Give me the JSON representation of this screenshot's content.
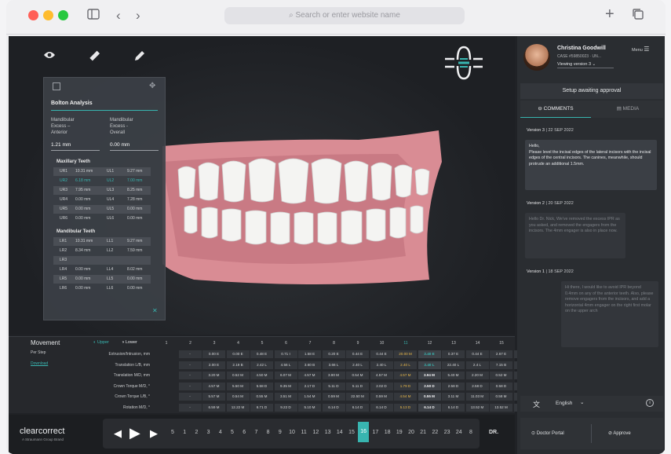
{
  "browser": {
    "url_placeholder": "Search or enter website name",
    "colors": {
      "close": "#ff5f57",
      "minimize": "#febc2e",
      "maximize": "#28c840"
    }
  },
  "toolbar": {
    "tools": [
      {
        "icon": "eye-icon"
      },
      {
        "icon": "ruler-icon"
      },
      {
        "icon": "pencil-icon"
      }
    ]
  },
  "bolton": {
    "title": "Bolton Analysis",
    "anterior_label_1": "Mandibular",
    "anterior_label_2": "Excess –",
    "anterior_label_3": "Anterior",
    "anterior_value": "1.21 mm",
    "overall_label_1": "Mandibular",
    "overall_label_2": "Excess -",
    "overall_label_3": "Overall",
    "overall_value": "0.00 mm",
    "maxillary_title": "Maxillary Teeth",
    "maxillary": [
      {
        "l": "UR1",
        "lv": "10.31 mm",
        "r": "UL1",
        "rv": "9.27 mm"
      },
      {
        "l": "UR2",
        "lv": "6.18 mm",
        "r": "UL2",
        "rv": "7.00 mm"
      },
      {
        "l": "UR3",
        "lv": "7.95 mm",
        "r": "UL3",
        "rv": "8.25 mm"
      },
      {
        "l": "UR4",
        "lv": "0.00 mm",
        "r": "UL4",
        "rv": "7.28 mm"
      },
      {
        "l": "UR5",
        "lv": "0.00 mm",
        "r": "UL5",
        "rv": "0.00 mm"
      },
      {
        "l": "UR6",
        "lv": "0.00 mm",
        "r": "UL6",
        "rv": "0.00 mm"
      }
    ],
    "mandibular_title": "Mandibular Teeth",
    "mandibular": [
      {
        "l": "LR1",
        "lv": "10.31 mm",
        "r": "LL1",
        "rv": "9.27 mm"
      },
      {
        "l": "LR2",
        "lv": "8.34 mm",
        "r": "LL2",
        "rv": "7.59 mm"
      },
      {
        "l": "LR3",
        "lv": "",
        "r": "",
        "rv": ""
      },
      {
        "l": "LR4",
        "lv": "0.00 mm",
        "r": "LL4",
        "rv": "8.02 mm"
      },
      {
        "l": "LR5",
        "lv": "0.00 mm",
        "r": "LL5",
        "rv": "0.00 mm"
      },
      {
        "l": "LR6",
        "lv": "0.00 mm",
        "r": "LL6",
        "rv": "0.00 mm"
      }
    ]
  },
  "movement": {
    "title": "Movement",
    "toggle_upper": "Upper",
    "toggle_lower": "Lower",
    "columns": [
      "1",
      "2",
      "3",
      "4",
      "5",
      "6",
      "7",
      "8",
      "9",
      "10",
      "11",
      "12",
      "13",
      "14",
      "15",
      "16"
    ],
    "per_step_label": "Per Step",
    "download_label": "Download",
    "rows": [
      {
        "label": "Extrusion/Intrusion, mm",
        "cells": [
          "-",
          "0.00 E",
          "0.00 E",
          "0.48 E",
          "0.71 I",
          "1.58 E",
          "0.20 E",
          "0.44 E",
          "0.44 E",
          "20.00 M",
          "2.40 E",
          "0.37 E",
          "0.44 E",
          "2.67 E",
          "0.60 E"
        ]
      },
      {
        "label": "Translation L/B, mm",
        "cells": [
          "-",
          "2.00 E",
          "2.19 B",
          "2.42 L",
          "4.56 L",
          "3.60 B",
          "3.66 L",
          "2.40 L",
          "2.40 L",
          "2.40 L",
          "2.40 L",
          "22.40 L",
          "2.4 L",
          "7.15 B",
          "5.23 L"
        ]
      },
      {
        "label": "Translation M/D, mm",
        "cells": [
          "-",
          "3.20 M",
          "0.52 M",
          "4.50 M",
          "6.07 M",
          "4.57 M",
          "3.90 M",
          "0.54 M",
          "4.57 M",
          "4.57 M",
          "3.94 M",
          "5.40 M",
          "2.20 M",
          "0.52 M",
          "0.54 M"
        ]
      },
      {
        "label": "Crown Torque M/D, °",
        "cells": [
          "-",
          "4.57 M",
          "5.50 M",
          "5.58 D",
          "9.35 M",
          "2.17 D",
          "5.11 D",
          "5.11 D",
          "2.02 D",
          "1.79 D",
          "2.50 D",
          "2.58 D",
          "2.58 D",
          "0.58 D",
          "2.20 M"
        ]
      },
      {
        "label": "Crown Torque L/B, °",
        "cells": [
          "-",
          "5.57 M",
          "0.54 M",
          "0.55 M",
          "3.51 M",
          "1.54 M",
          "0.59 M",
          "22.50 M",
          "0.59 M",
          "4.54 M",
          "0.55 M",
          "3.11 M",
          "11.03 M",
          "0.58 M",
          "0.50 M"
        ]
      },
      {
        "label": "Rotation M/D, °",
        "cells": [
          "-",
          "6.59 M",
          "12.22 M",
          "6.71 D",
          "9.22 D",
          "5.10 M",
          "6.14 D",
          "6.14 D",
          "6.14 D",
          "5.13 D",
          "6.14 D",
          "6.14 D",
          "13.52 M",
          "13.52 M",
          "2.20 M"
        ]
      }
    ]
  },
  "timeline": {
    "brand": "clearcorrect",
    "brand_sub": "A Straumann Group Brand",
    "steps": [
      "5",
      "1",
      "2",
      "3",
      "4",
      "5",
      "6",
      "7",
      "8",
      "9",
      "10",
      "11",
      "12",
      "13",
      "14",
      "15",
      "16",
      "17",
      "18",
      "19",
      "20",
      "21",
      "22",
      "23",
      "24",
      "8"
    ],
    "active_step": "16",
    "end_label": "DR."
  },
  "user": {
    "name": "Christina Goodwill",
    "case": "CASE #59850023 · UN...",
    "viewing": "Viewing version 3",
    "menu": "Menu"
  },
  "panel": {
    "status": "Setup awaiting approval",
    "tab_comments": "COMMENTS",
    "tab_media": "MEDIA",
    "version3_label": "Version 3",
    "version3_date": "22 SEP 2022",
    "version3_msg_1": "Hello,",
    "version3_msg_2": "Please level the incisal edges of the lateral incisors with the incisal edges of the central incisors. The canines, meanwhile, should protrude an additional 1.5mm.",
    "version2_label": "Version 2",
    "version2_date": "20 SEP 2022",
    "version2_msg": "Hello Dr. Nick, We've removed the excess IPR as you asked, and removed the engagers from the incisors. The 4mm engager is also in place now.",
    "version1_label": "Version 1",
    "version1_date": "18 SEP 2022",
    "version1_msg": "Hi there, I would like to avoid IPR beyond 0.4mm on any of the anterior teeth. Also, please remove engagers from the incisors, and add a horizontal 4mm engager on the right first molar on the upper arch",
    "language": "English",
    "doctor_portal": "Doctor Portal",
    "approve": "Approve"
  },
  "colors": {
    "accent": "#38b5b0",
    "highlight": "#e8b84a",
    "background": "#202226"
  }
}
